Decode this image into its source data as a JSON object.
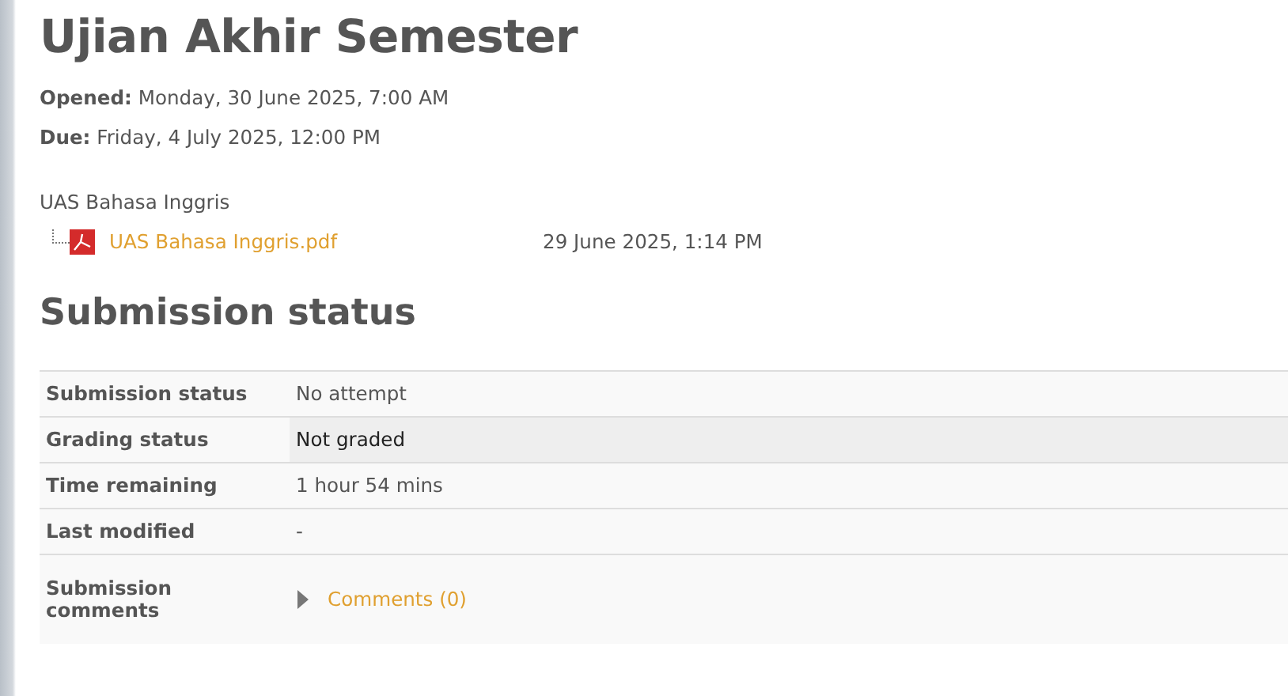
{
  "title": "Ujian Akhir Semester",
  "dates": [
    {
      "label": "Opened:",
      "value": "Monday, 30 June 2025, 7:00 AM"
    },
    {
      "label": "Due:",
      "value": "Friday, 4 July 2025, 12:00 PM"
    }
  ],
  "intro": "UAS Bahasa Inggris",
  "files": [
    {
      "name": "UAS Bahasa Inggris.pdf",
      "date": "29 June 2025, 1:14 PM"
    }
  ],
  "section_heading": "Submission status",
  "status_rows": [
    {
      "kind": "plain",
      "label": "Submission status",
      "value": "No attempt"
    },
    {
      "kind": "status",
      "label": "Grading status",
      "value": "Not graded"
    },
    {
      "kind": "plain",
      "label": "Time remaining",
      "value": "1 hour 54 mins"
    },
    {
      "kind": "plain",
      "label": "Last modified",
      "value": "-"
    },
    {
      "kind": "comments",
      "label": "Submission comments",
      "value": "Comments (0)",
      "expanded": false
    }
  ]
}
